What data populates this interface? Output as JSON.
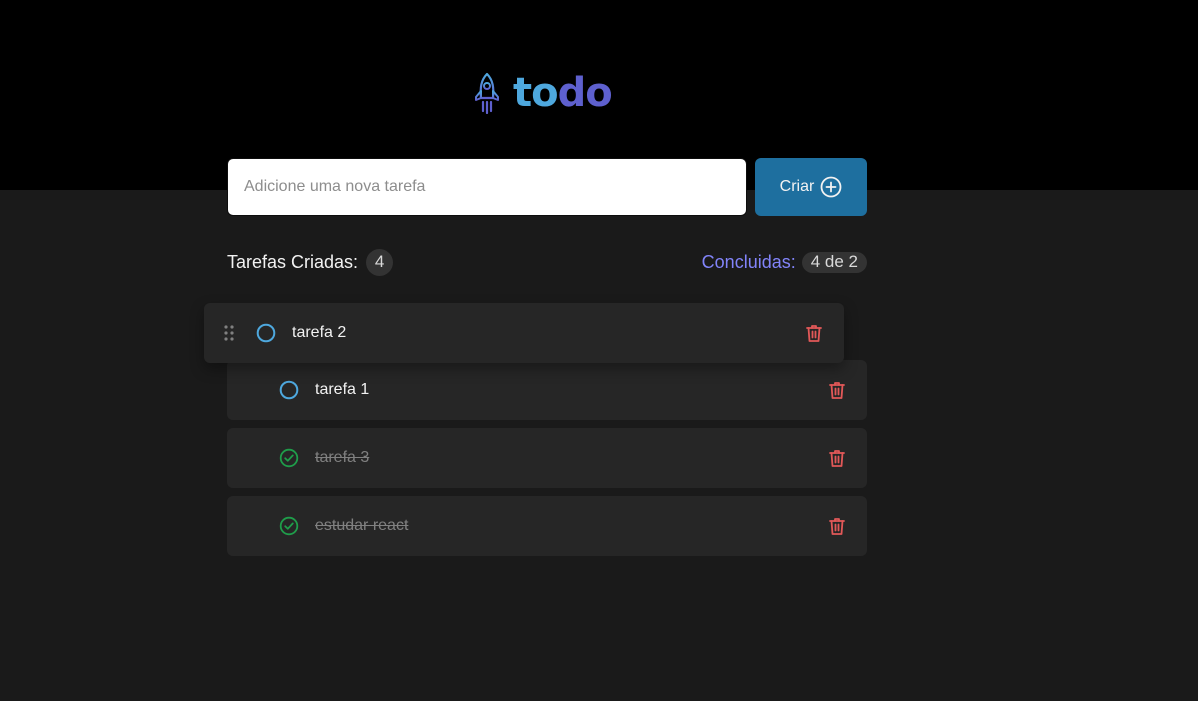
{
  "app": {
    "logo_part1": "to",
    "logo_part2": "do",
    "logo_icon": "rocket-icon"
  },
  "new_task": {
    "placeholder": "Adicione uma nova tarefa",
    "value": "",
    "button_label": "Criar",
    "button_icon": "plus-circle-icon"
  },
  "stats": {
    "created_label": "Tarefas Criadas:",
    "created_count": "4",
    "done_label": "Concluidas:",
    "done_value": "4 de 2"
  },
  "tasks": [
    {
      "text": "tarefa 2",
      "done": false,
      "dragging": true
    },
    {
      "text": "tarefa 1",
      "done": false
    },
    {
      "text": "tarefa 3",
      "done": true
    },
    {
      "text": "estudar react",
      "done": true
    }
  ],
  "colors": {
    "accent_blue": "#4ea8de",
    "accent_purple": "#5e60ce",
    "button_bg": "#1e6f9f",
    "done_check": "#1f9d4a",
    "trash": "#e25858",
    "done_label": "#8284fa"
  }
}
